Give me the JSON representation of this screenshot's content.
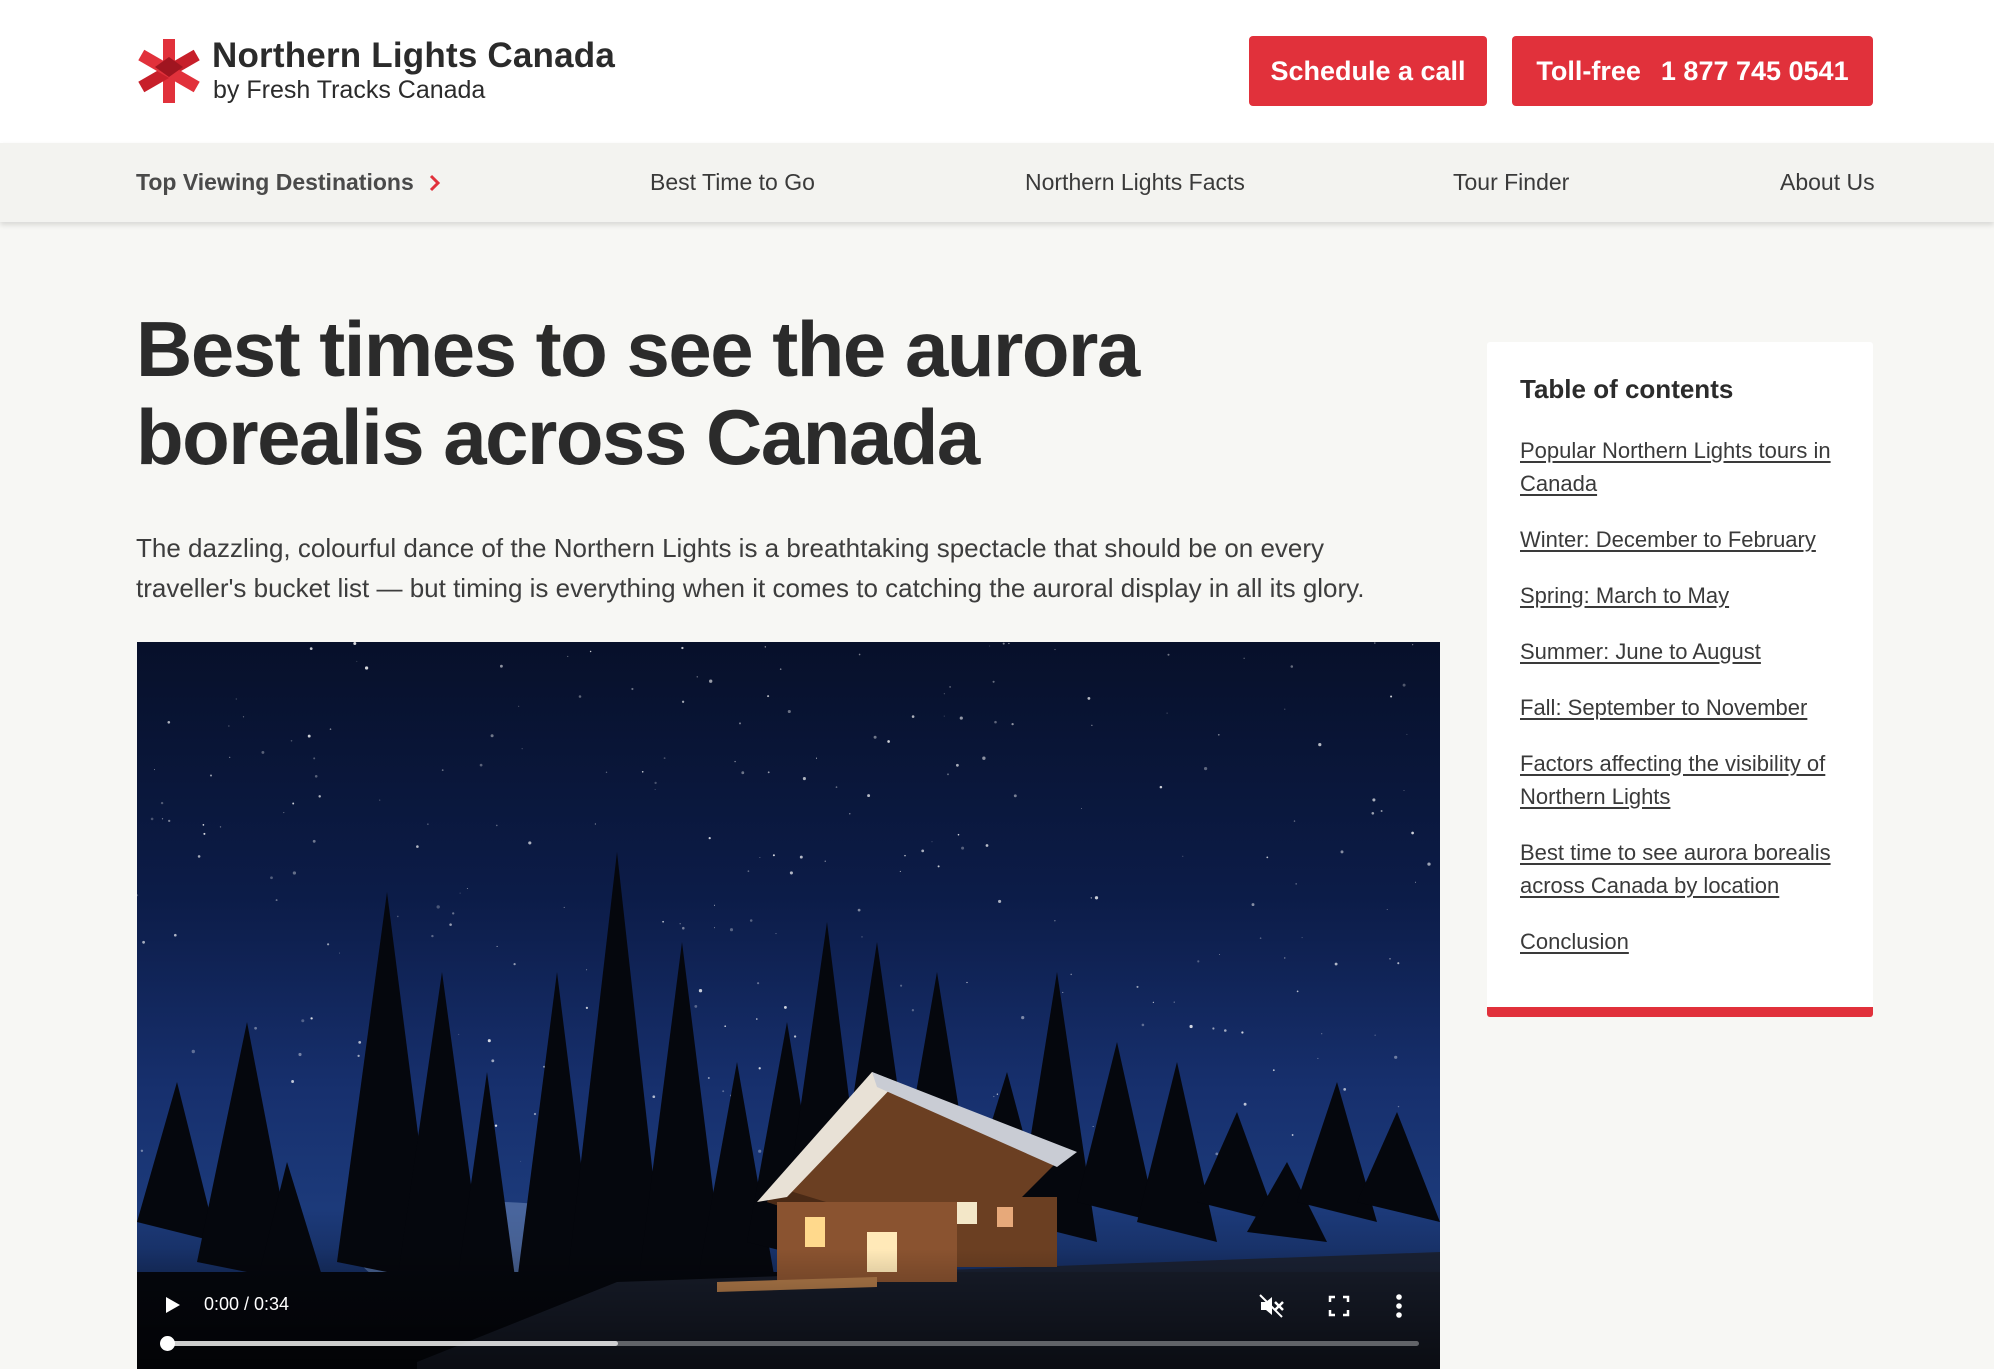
{
  "brand": {
    "title": "Northern Lights Canada",
    "subtitle": "by Fresh Tracks Canada",
    "accent_color": "#e1313b",
    "logo_icon": "maple-star-icon"
  },
  "header": {
    "schedule_label": "Schedule a call",
    "tollfree_label": "Toll-free",
    "tollfree_number": "1 877 745 0541"
  },
  "nav": {
    "items": [
      {
        "label": "Top Viewing Destinations",
        "icon": "chevron-right-icon"
      },
      {
        "label": "Best Time to Go"
      },
      {
        "label": "Northern Lights Facts"
      },
      {
        "label": "Tour Finder"
      },
      {
        "label": "About Us"
      }
    ]
  },
  "article": {
    "title": "Best times to see the aurora borealis across Canada",
    "intro": "The dazzling, colourful dance of the Northern Lights is a breathtaking spectacle that should be on every traveller's bucket list — but timing is everything when it comes to catching the auroral display in all its glory."
  },
  "video": {
    "time": "0:00 / 0:34",
    "progress": 0,
    "buffered": 0.36,
    "controls": [
      "play-icon",
      "mute-icon",
      "fullscreen-icon",
      "more-vertical-icon"
    ]
  },
  "toc": {
    "title": "Table of contents",
    "items": [
      "Popular Northern Lights tours in Canada",
      "Winter: December to February",
      "Spring: March to May",
      "Summer: June to August",
      "Fall: September to November",
      "Factors affecting the visibility of Northern Lights",
      "Best time to see aurora borealis across Canada by location",
      "Conclusion"
    ]
  }
}
